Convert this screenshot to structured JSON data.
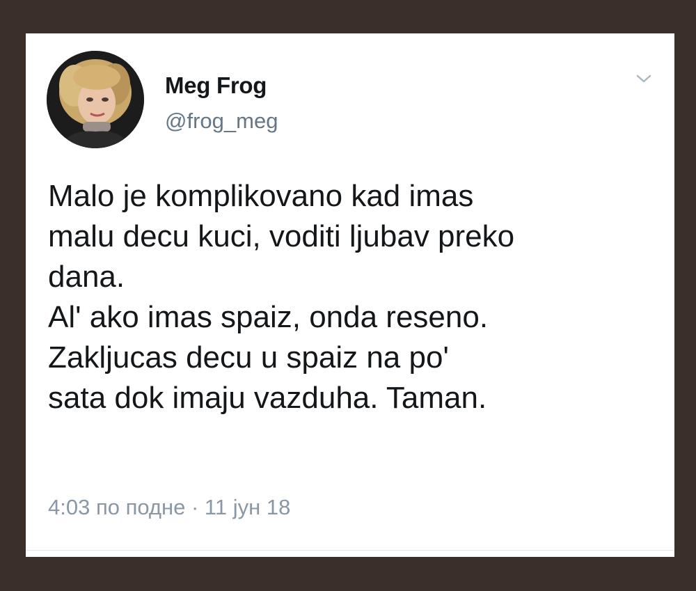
{
  "tweet": {
    "author": {
      "name": "Meg Frog",
      "handle": "@frog_meg",
      "avatar_icon": "user-avatar-photo"
    },
    "menu_icon": "chevron-down-icon",
    "text_lines": [
      "Malo je komplikovano kad imas",
      "malu decu kuci, voditi ljubav preko",
      "dana.",
      "Al' ako imas spaiz, onda reseno.",
      "Zakljucas decu u spaiz na po'",
      "sata dok imaju vazduha. Taman."
    ],
    "timestamp": "4:03 по подне · 11 јун 18"
  },
  "colors": {
    "background": "#3b3029",
    "card": "#ffffff",
    "text": "#14171a",
    "secondary_text": "#657786"
  }
}
